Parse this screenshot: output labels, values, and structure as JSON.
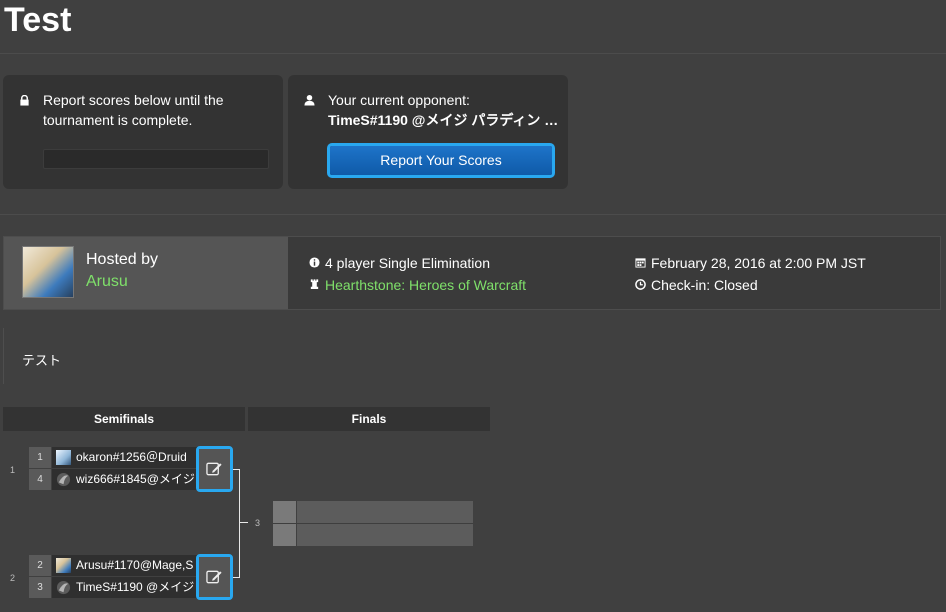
{
  "page": {
    "title": "Test"
  },
  "report_card": {
    "text": "Report scores below until the tournament is complete."
  },
  "opponent_card": {
    "label": "Your current opponent:",
    "opponent": "TimeS#1190 @メイジ パラディン …",
    "button": "Report Your Scores"
  },
  "info": {
    "hosted_by_label": "Hosted by",
    "host": "Arusu",
    "format": "4 player Single Elimination",
    "game": "Hearthstone: Heroes of Warcraft",
    "date": "February 28, 2016 at 2:00 PM JST",
    "checkin": "Check-in: Closed"
  },
  "description": "テスト",
  "bracket": {
    "rounds": [
      "Semifinals",
      "Finals"
    ],
    "matches": [
      {
        "number": "1",
        "players": [
          {
            "seed": "1",
            "name": "okaron#1256＠Druid"
          },
          {
            "seed": "4",
            "name": "wiz666#1845@メイジ,"
          }
        ]
      },
      {
        "number": "2",
        "players": [
          {
            "seed": "2",
            "name": "Arusu#1170@Mage,S"
          },
          {
            "seed": "3",
            "name": "TimeS#1190 @メイジ"
          }
        ]
      },
      {
        "number": "3",
        "players": [
          {
            "seed": "",
            "name": ""
          },
          {
            "seed": "",
            "name": ""
          }
        ]
      }
    ]
  },
  "icons": {
    "lock": "lock-icon",
    "user": "user-icon",
    "info": "info-icon",
    "rook": "rook-icon",
    "calendar": "calendar-icon",
    "clock": "clock-icon",
    "edit": "edit-icon",
    "player_avatar": "avatar-icon",
    "player_logo": "logo-icon"
  },
  "colors": {
    "accent": "#29a8f0",
    "button": "#1e74c9",
    "link_green": "#7fe06a",
    "background": "#404040"
  }
}
